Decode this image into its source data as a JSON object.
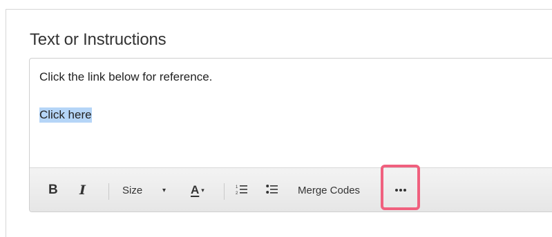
{
  "section": {
    "title": "Text or Instructions"
  },
  "editor": {
    "paragraph": "Click the link below for reference.",
    "link_text": "Click here"
  },
  "toolbar": {
    "bold_label": "B",
    "italic_label": "I",
    "size_label": "Size",
    "dropdown_caret": "▾",
    "font_color_label": "A",
    "merge_codes_label": "Merge Codes",
    "icons": [
      "bold-icon",
      "italic-icon",
      "font-color-icon",
      "numbered-list-icon",
      "bulleted-list-icon",
      "more-options-icon"
    ]
  },
  "highlight": {
    "color": "#f0607e"
  }
}
